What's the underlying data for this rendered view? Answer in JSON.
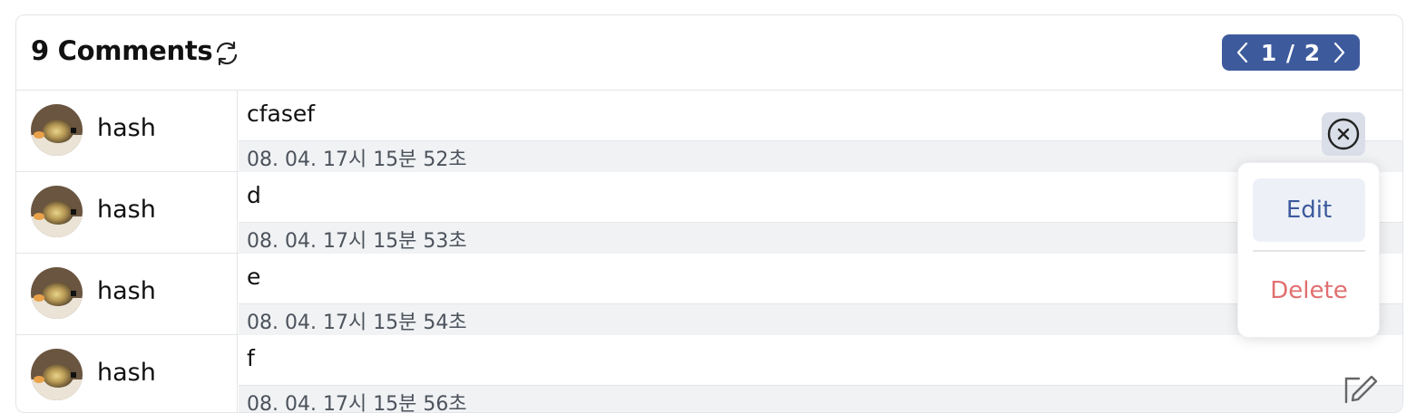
{
  "header": {
    "title": "9 Comments",
    "refresh_icon": "refresh-icon",
    "pager": {
      "prev_icon": "chevron-left-icon",
      "next_icon": "chevron-right-icon",
      "label": "1 / 2"
    }
  },
  "comments": [
    {
      "user": "hash",
      "text": "cfasef",
      "time": "08. 04. 17시 15분 52초"
    },
    {
      "user": "hash",
      "text": "d",
      "time": "08. 04. 17시 15분 53초"
    },
    {
      "user": "hash",
      "text": "e",
      "time": "08. 04. 17시 15분 54초"
    },
    {
      "user": "hash",
      "text": "f",
      "time": "08. 04. 17시 15분 56초"
    }
  ],
  "menu": {
    "close_icon": "close-circle-icon",
    "edit_label": "Edit",
    "delete_label": "Delete"
  },
  "edit_icon": "pencil-icon",
  "colors": {
    "accent": "#3d5a9c",
    "danger": "#e16f6f",
    "meta_bg": "#f1f2f4"
  }
}
